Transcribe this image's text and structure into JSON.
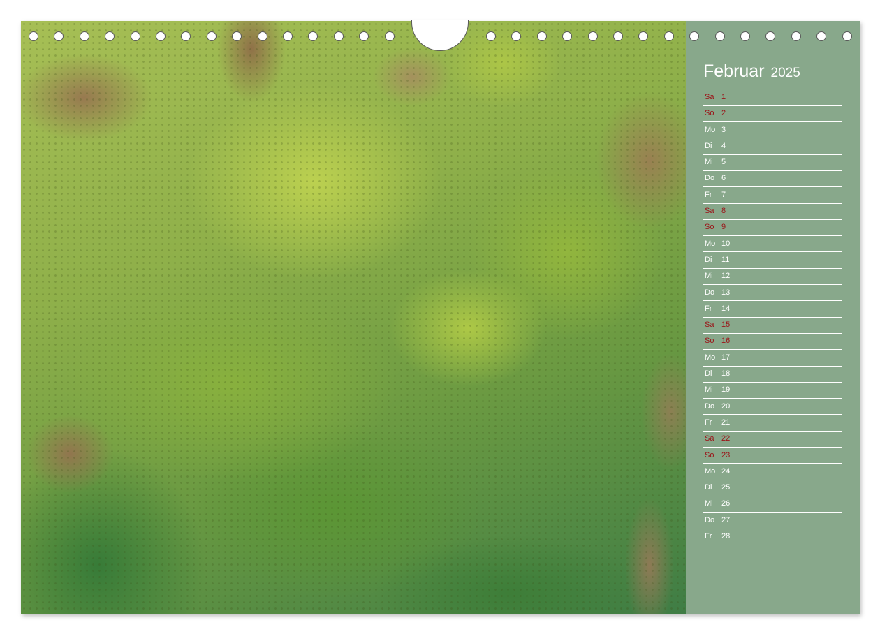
{
  "calendar": {
    "month": "Februar",
    "year": "2025",
    "weekend_color": "#9b1418",
    "panel_color": "#88a88b",
    "days": [
      {
        "dow": "Sa",
        "day": "1",
        "weekend": true
      },
      {
        "dow": "So",
        "day": "2",
        "weekend": true
      },
      {
        "dow": "Mo",
        "day": "3",
        "weekend": false
      },
      {
        "dow": "Di",
        "day": "4",
        "weekend": false
      },
      {
        "dow": "Mi",
        "day": "5",
        "weekend": false
      },
      {
        "dow": "Do",
        "day": "6",
        "weekend": false
      },
      {
        "dow": "Fr",
        "day": "7",
        "weekend": false
      },
      {
        "dow": "Sa",
        "day": "8",
        "weekend": true
      },
      {
        "dow": "So",
        "day": "9",
        "weekend": true
      },
      {
        "dow": "Mo",
        "day": "10",
        "weekend": false
      },
      {
        "dow": "Di",
        "day": "11",
        "weekend": false
      },
      {
        "dow": "Mi",
        "day": "12",
        "weekend": false
      },
      {
        "dow": "Do",
        "day": "13",
        "weekend": false
      },
      {
        "dow": "Fr",
        "day": "14",
        "weekend": false
      },
      {
        "dow": "Sa",
        "day": "15",
        "weekend": true
      },
      {
        "dow": "So",
        "day": "16",
        "weekend": true
      },
      {
        "dow": "Mo",
        "day": "17",
        "weekend": false
      },
      {
        "dow": "Di",
        "day": "18",
        "weekend": false
      },
      {
        "dow": "Mi",
        "day": "19",
        "weekend": false
      },
      {
        "dow": "Do",
        "day": "20",
        "weekend": false
      },
      {
        "dow": "Fr",
        "day": "21",
        "weekend": false
      },
      {
        "dow": "Sa",
        "day": "22",
        "weekend": true
      },
      {
        "dow": "So",
        "day": "23",
        "weekend": true
      },
      {
        "dow": "Mo",
        "day": "24",
        "weekend": false
      },
      {
        "dow": "Di",
        "day": "25",
        "weekend": false
      },
      {
        "dow": "Mi",
        "day": "26",
        "weekend": false
      },
      {
        "dow": "Do",
        "day": "27",
        "weekend": false
      },
      {
        "dow": "Fr",
        "day": "28",
        "weekend": false
      }
    ]
  }
}
